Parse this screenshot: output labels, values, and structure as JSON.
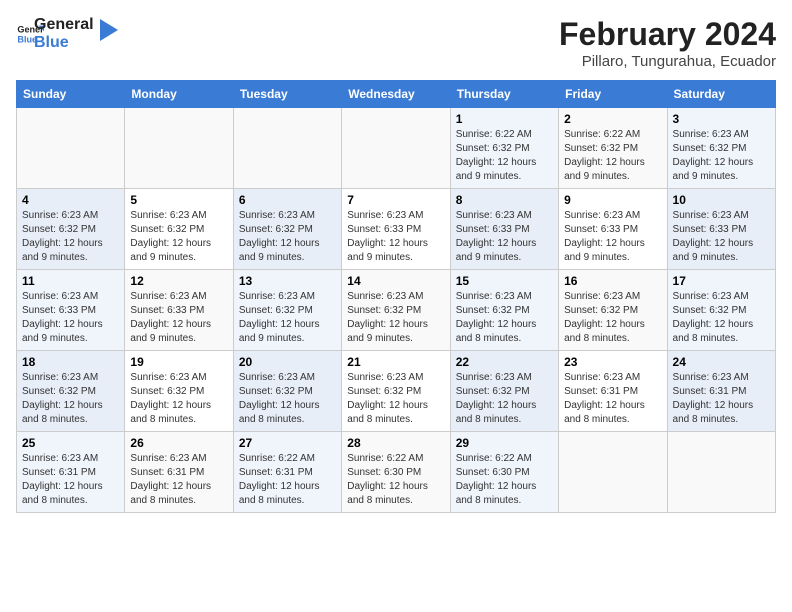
{
  "logo": {
    "line1": "General",
    "line2": "Blue"
  },
  "title": "February 2024",
  "subtitle": "Pillaro, Tungurahua, Ecuador",
  "headers": [
    "Sunday",
    "Monday",
    "Tuesday",
    "Wednesday",
    "Thursday",
    "Friday",
    "Saturday"
  ],
  "weeks": [
    [
      {
        "day": "",
        "info": ""
      },
      {
        "day": "",
        "info": ""
      },
      {
        "day": "",
        "info": ""
      },
      {
        "day": "",
        "info": ""
      },
      {
        "day": "1",
        "info": "Sunrise: 6:22 AM\nSunset: 6:32 PM\nDaylight: 12 hours and 9 minutes."
      },
      {
        "day": "2",
        "info": "Sunrise: 6:22 AM\nSunset: 6:32 PM\nDaylight: 12 hours and 9 minutes."
      },
      {
        "day": "3",
        "info": "Sunrise: 6:23 AM\nSunset: 6:32 PM\nDaylight: 12 hours and 9 minutes."
      }
    ],
    [
      {
        "day": "4",
        "info": "Sunrise: 6:23 AM\nSunset: 6:32 PM\nDaylight: 12 hours and 9 minutes."
      },
      {
        "day": "5",
        "info": "Sunrise: 6:23 AM\nSunset: 6:32 PM\nDaylight: 12 hours and 9 minutes."
      },
      {
        "day": "6",
        "info": "Sunrise: 6:23 AM\nSunset: 6:32 PM\nDaylight: 12 hours and 9 minutes."
      },
      {
        "day": "7",
        "info": "Sunrise: 6:23 AM\nSunset: 6:33 PM\nDaylight: 12 hours and 9 minutes."
      },
      {
        "day": "8",
        "info": "Sunrise: 6:23 AM\nSunset: 6:33 PM\nDaylight: 12 hours and 9 minutes."
      },
      {
        "day": "9",
        "info": "Sunrise: 6:23 AM\nSunset: 6:33 PM\nDaylight: 12 hours and 9 minutes."
      },
      {
        "day": "10",
        "info": "Sunrise: 6:23 AM\nSunset: 6:33 PM\nDaylight: 12 hours and 9 minutes."
      }
    ],
    [
      {
        "day": "11",
        "info": "Sunrise: 6:23 AM\nSunset: 6:33 PM\nDaylight: 12 hours and 9 minutes."
      },
      {
        "day": "12",
        "info": "Sunrise: 6:23 AM\nSunset: 6:33 PM\nDaylight: 12 hours and 9 minutes."
      },
      {
        "day": "13",
        "info": "Sunrise: 6:23 AM\nSunset: 6:32 PM\nDaylight: 12 hours and 9 minutes."
      },
      {
        "day": "14",
        "info": "Sunrise: 6:23 AM\nSunset: 6:32 PM\nDaylight: 12 hours and 9 minutes."
      },
      {
        "day": "15",
        "info": "Sunrise: 6:23 AM\nSunset: 6:32 PM\nDaylight: 12 hours and 8 minutes."
      },
      {
        "day": "16",
        "info": "Sunrise: 6:23 AM\nSunset: 6:32 PM\nDaylight: 12 hours and 8 minutes."
      },
      {
        "day": "17",
        "info": "Sunrise: 6:23 AM\nSunset: 6:32 PM\nDaylight: 12 hours and 8 minutes."
      }
    ],
    [
      {
        "day": "18",
        "info": "Sunrise: 6:23 AM\nSunset: 6:32 PM\nDaylight: 12 hours and 8 minutes."
      },
      {
        "day": "19",
        "info": "Sunrise: 6:23 AM\nSunset: 6:32 PM\nDaylight: 12 hours and 8 minutes."
      },
      {
        "day": "20",
        "info": "Sunrise: 6:23 AM\nSunset: 6:32 PM\nDaylight: 12 hours and 8 minutes."
      },
      {
        "day": "21",
        "info": "Sunrise: 6:23 AM\nSunset: 6:32 PM\nDaylight: 12 hours and 8 minutes."
      },
      {
        "day": "22",
        "info": "Sunrise: 6:23 AM\nSunset: 6:32 PM\nDaylight: 12 hours and 8 minutes."
      },
      {
        "day": "23",
        "info": "Sunrise: 6:23 AM\nSunset: 6:31 PM\nDaylight: 12 hours and 8 minutes."
      },
      {
        "day": "24",
        "info": "Sunrise: 6:23 AM\nSunset: 6:31 PM\nDaylight: 12 hours and 8 minutes."
      }
    ],
    [
      {
        "day": "25",
        "info": "Sunrise: 6:23 AM\nSunset: 6:31 PM\nDaylight: 12 hours and 8 minutes."
      },
      {
        "day": "26",
        "info": "Sunrise: 6:23 AM\nSunset: 6:31 PM\nDaylight: 12 hours and 8 minutes."
      },
      {
        "day": "27",
        "info": "Sunrise: 6:22 AM\nSunset: 6:31 PM\nDaylight: 12 hours and 8 minutes."
      },
      {
        "day": "28",
        "info": "Sunrise: 6:22 AM\nSunset: 6:30 PM\nDaylight: 12 hours and 8 minutes."
      },
      {
        "day": "29",
        "info": "Sunrise: 6:22 AM\nSunset: 6:30 PM\nDaylight: 12 hours and 8 minutes."
      },
      {
        "day": "",
        "info": ""
      },
      {
        "day": "",
        "info": ""
      }
    ]
  ]
}
